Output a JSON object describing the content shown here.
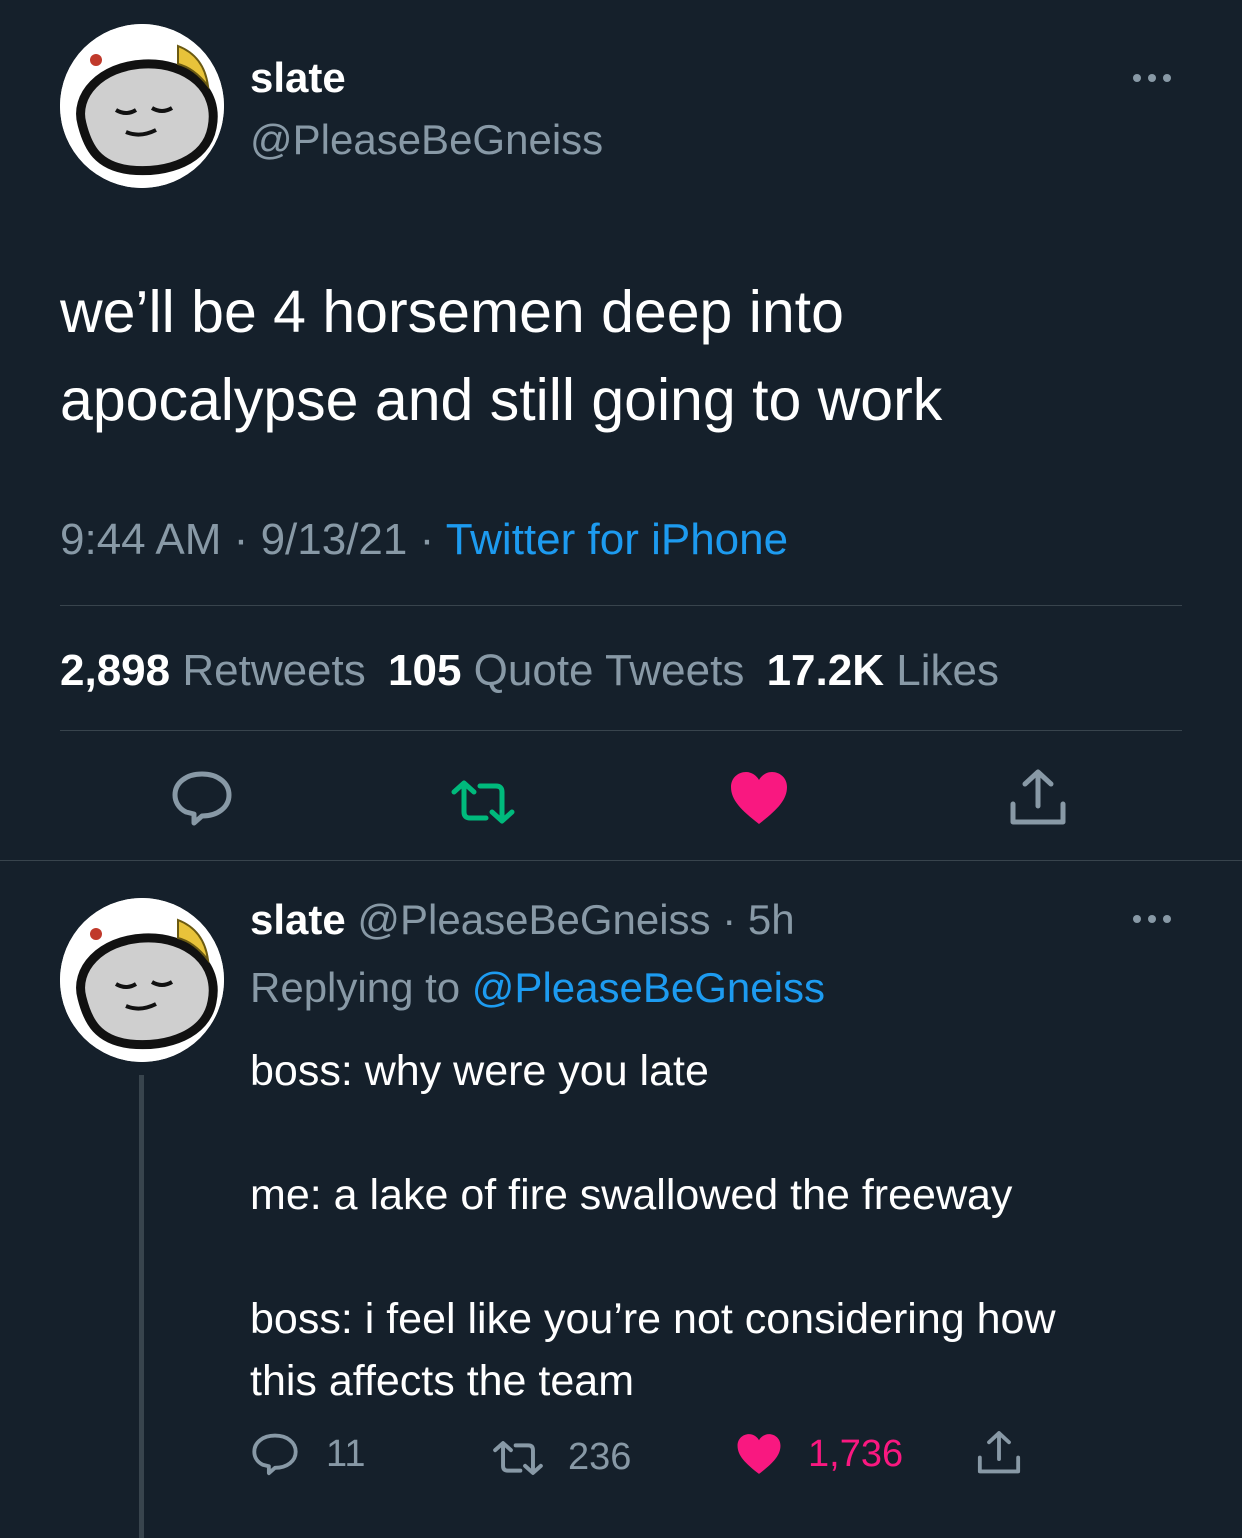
{
  "main_tweet": {
    "display_name": "slate",
    "handle": "@PleaseBeGneiss",
    "text_line1": "we’ll be 4 horsemen deep into",
    "text_line2": "apocalypse and still going to work",
    "time": "9:44 AM",
    "date": "9/13/21",
    "separator": "·",
    "source": "Twitter for iPhone",
    "stats": {
      "retweets_count": "2,898",
      "retweets_label": "Retweets",
      "quotes_count": "105",
      "quotes_label": "Quote Tweets",
      "likes_count": "17.2K",
      "likes_label": "Likes"
    },
    "actions": [
      "reply-icon",
      "retweet-icon",
      "like-icon",
      "share-icon"
    ],
    "liked": true,
    "retweeted": true
  },
  "reply_tweet": {
    "display_name": "slate",
    "handle": "@PleaseBeGneiss",
    "separator": "·",
    "age": "5h",
    "replying_label": "Replying to",
    "replying_handle": "@PleaseBeGneiss",
    "line1": "boss: why were you late",
    "line2": "me: a lake of fire swallowed the freeway",
    "line3": "boss: i feel like you’re not considering how",
    "line4": "this affects the team",
    "reply_count": "11",
    "retweet_count": "236",
    "like_count": "1,736",
    "liked": true
  },
  "colors": {
    "background": "#15202b",
    "text": "#ffffff",
    "muted": "#8899a6",
    "link": "#1d9bf0",
    "like": "#f91880",
    "retweet": "#00ba7c",
    "divider": "#38444d"
  }
}
